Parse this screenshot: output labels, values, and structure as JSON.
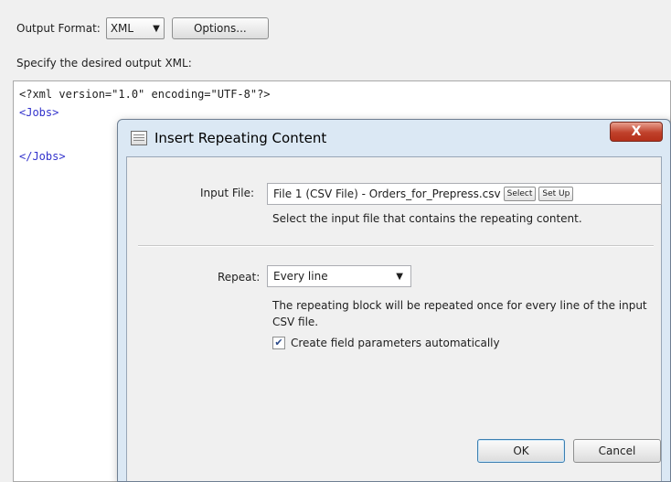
{
  "main": {
    "output_format_label": "Output Format:",
    "output_format_value": "XML",
    "options_button": "Options...",
    "specify_label": "Specify the desired output XML:",
    "editor_lines": [
      "<?xml version=\"1.0\" encoding=\"UTF-8\"?>",
      "<Jobs>",
      "</Jobs>"
    ]
  },
  "dialog": {
    "title": "Insert Repeating Content",
    "close_symbol": "X",
    "input_file_label": "Input File:",
    "input_file_value": "File 1 (CSV File) - Orders_for_Prepress.csv",
    "select_button": "Select",
    "setup_button": "Set Up",
    "input_file_hint": "Select the input file that contains the repeating content.",
    "repeat_label": "Repeat:",
    "repeat_value": "Every line",
    "repeat_hint": "The repeating block will be repeated once for every line of the input CSV file.",
    "checkbox_label": "Create field parameters automatically",
    "checkbox_checked": true,
    "ok_button": "OK",
    "cancel_button": "Cancel"
  },
  "colors": {
    "xml_tag": "#3333cc",
    "dialog_frame": "#dbe8f4",
    "close_button": "#c0412b"
  }
}
